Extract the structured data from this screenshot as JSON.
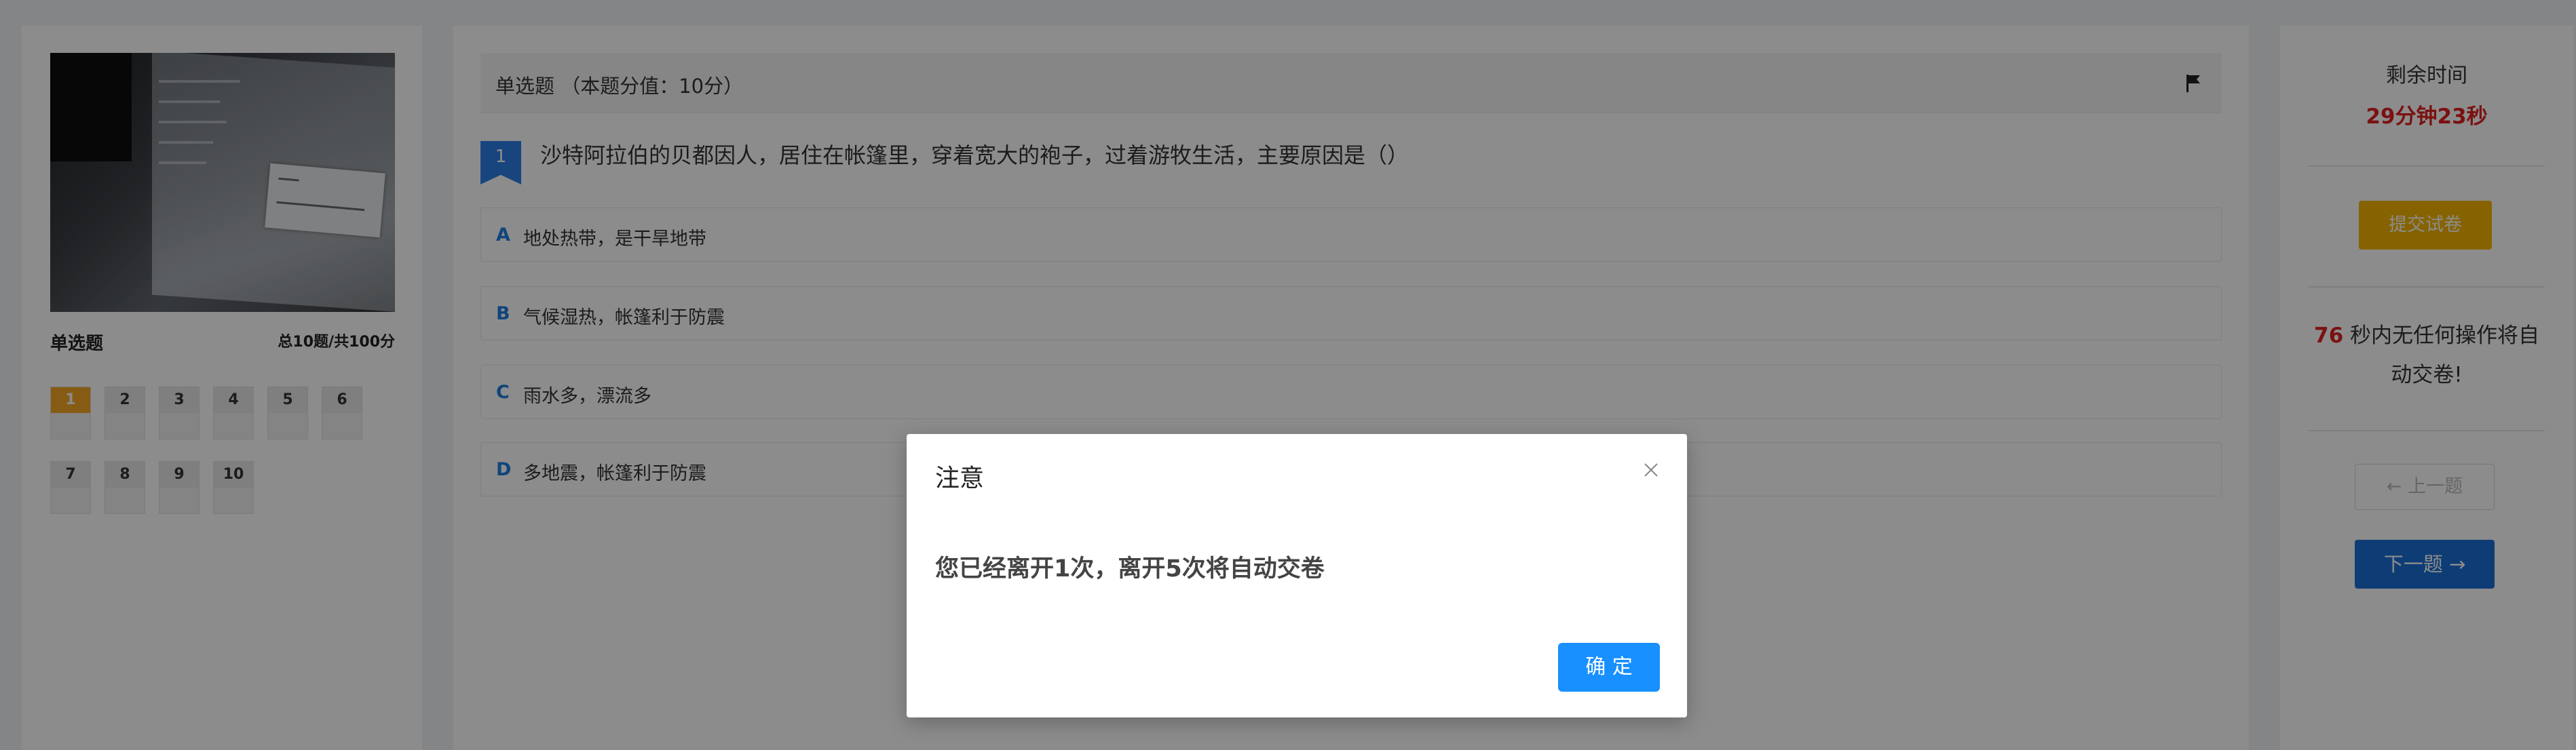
{
  "left_panel": {
    "section_title": "单选题",
    "total": "总10题/共100分",
    "questions": [
      "1",
      "2",
      "3",
      "4",
      "5",
      "6",
      "7",
      "8",
      "9",
      "10"
    ],
    "current_index": 0
  },
  "center": {
    "header": "单选题 （本题分值：10分）",
    "question_number": "1",
    "question_text": "沙特阿拉伯的贝都因人，居住在帐篷里，穿着宽大的袍子，过着游牧生活，主要原因是（）",
    "options": [
      {
        "letter": "A",
        "text": "地处热带，是干旱地带"
      },
      {
        "letter": "B",
        "text": "气候湿热，帐篷利于防震"
      },
      {
        "letter": "C",
        "text": "雨水多，漂流多"
      },
      {
        "letter": "D",
        "text": "多地震，帐篷利于防震"
      }
    ]
  },
  "right_panel": {
    "time_label": "剩余时间",
    "time_value": "29分钟23秒",
    "submit_label": "提交试卷",
    "idle_seconds": "76",
    "idle_text": "秒内无任何操作将自动交卷!",
    "prev_label": "← 上一题",
    "next_label": "下一题 →"
  },
  "modal": {
    "title": "注意",
    "message": "您已经离开1次，离开5次将自动交卷",
    "ok_label": "确 定"
  },
  "colors": {
    "accent_blue": "#1890ff",
    "warning_red": "#e02020",
    "submit_yellow": "#f5b400",
    "current_question": "#f5a623"
  }
}
